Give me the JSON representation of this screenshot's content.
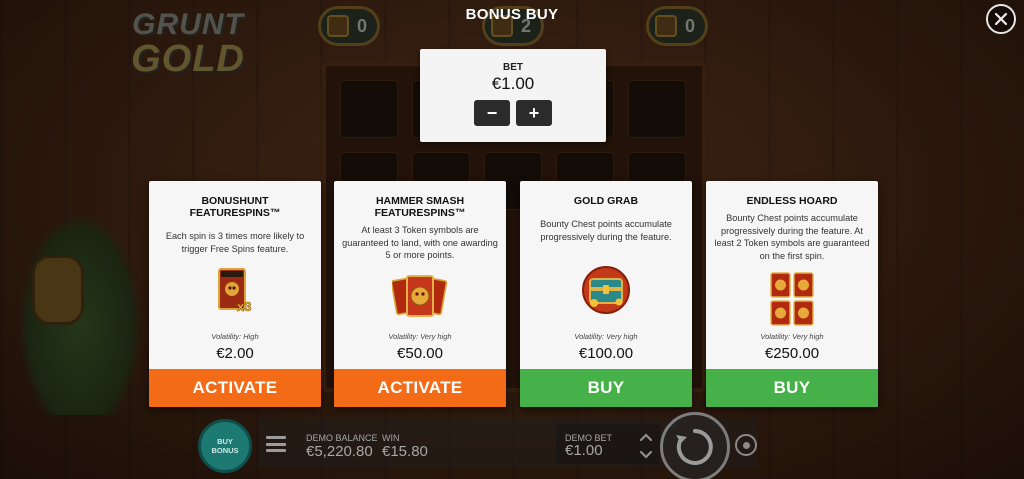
{
  "header": {
    "title": "BONUS BUY"
  },
  "background": {
    "logo_line1": "GRUNT",
    "logo_line2": "GOLD",
    "counters": [
      "0",
      "2",
      "0"
    ]
  },
  "bet": {
    "label": "BET",
    "value": "€1.00",
    "minus": "−",
    "plus": "+"
  },
  "cards": [
    {
      "title": "BONUSHUNT FEATURESPINS™",
      "description": "Each spin is 3 times more likely to trigger Free Spins feature.",
      "icon": "scatter-x3-icon",
      "volatility": "Volatility: High",
      "price": "€2.00",
      "action": "ACTIVATE",
      "action_color": "#f36b16"
    },
    {
      "title": "HAMMER SMASH FEATURESPINS™",
      "description": "At least 3 Token symbols are guaranteed to land, with one awarding 5 or more points.",
      "icon": "token-cards-icon",
      "volatility": "Volatility: Very high",
      "price": "€50.00",
      "action": "ACTIVATE",
      "action_color": "#f36b16"
    },
    {
      "title": "GOLD GRAB",
      "description": "Bounty Chest points accumulate progressively during the feature.",
      "icon": "bounty-chest-icon",
      "volatility": "Volatility: Very high",
      "price": "€100.00",
      "action": "BUY",
      "action_color": "#47b149"
    },
    {
      "title": "ENDLESS HOARD",
      "description": "Bounty Chest points accumulate progressively during the feature. At least 2 Token symbols are guaranteed on the first spin.",
      "icon": "token-grid-icon",
      "volatility": "Volatility: Very high",
      "price": "€250.00",
      "action": "BUY",
      "action_color": "#47b149"
    }
  ],
  "bottom_bar": {
    "buy_bonus_line1": "BUY",
    "buy_bonus_line2": "BONUS",
    "demo_balance_label": "DEMO BALANCE",
    "demo_balance_value": "€5,220.80",
    "win_label": "WIN",
    "win_value": "€15.80",
    "demo_bet_label": "DEMO BET",
    "demo_bet_value": "€1.00"
  }
}
